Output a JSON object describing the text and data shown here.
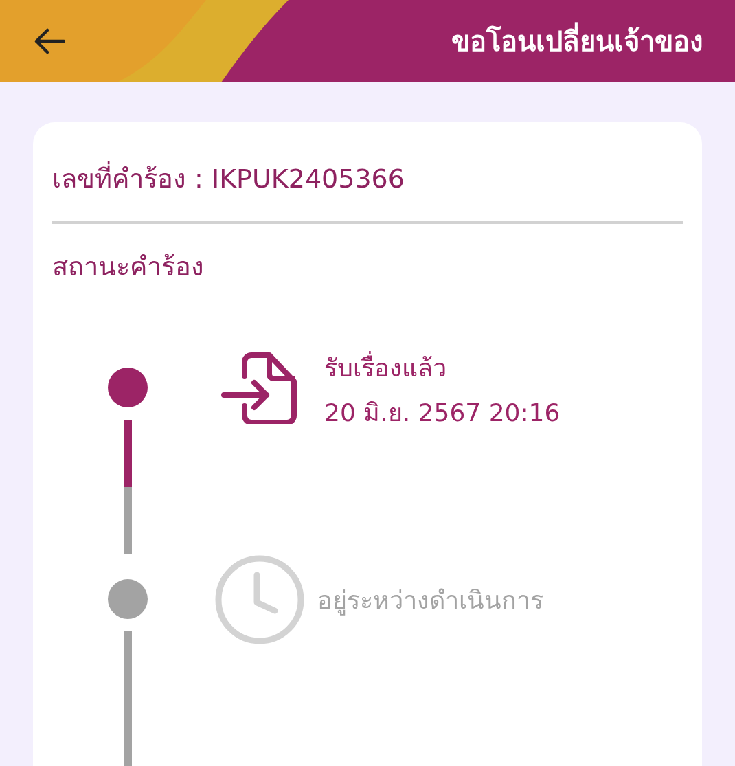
{
  "header": {
    "title": "ขอโอนเปลี่ยนเจ้าของ"
  },
  "request": {
    "label": "เลขที่คำร้อง : IKPUK2405366",
    "status_heading": "สถานะคำร้อง"
  },
  "steps": [
    {
      "kind": "received",
      "completed": true,
      "title": "รับเรื่องแล้ว",
      "date": "20 มิ.ย. 2567 20:16"
    },
    {
      "kind": "in_progress",
      "completed": false,
      "title": "อยู่ระหว่างดำเนินการ"
    }
  ]
}
